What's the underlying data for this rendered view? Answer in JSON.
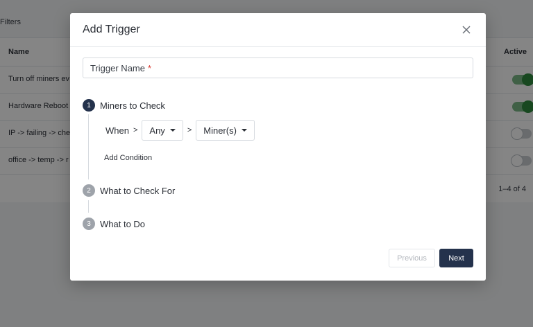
{
  "background": {
    "filters_label": "Filters",
    "columns": {
      "name": "Name",
      "active": "Active"
    },
    "rows": [
      {
        "name": "Turn off miners ev",
        "active": true
      },
      {
        "name": "Hardware Reboot",
        "active": true
      },
      {
        "name": "IP -> failing -> che",
        "active": false
      },
      {
        "name": "office -> temp -> r",
        "active": false
      }
    ],
    "pagination": "1–4 of 4"
  },
  "modal": {
    "title": "Add Trigger",
    "close_icon": "close-icon",
    "trigger_name_placeholder": "Trigger Name",
    "required_mark": "*",
    "steps": [
      {
        "number": "1",
        "label": "Miners to Check",
        "state": "active"
      },
      {
        "number": "2",
        "label": "What to Check For",
        "state": "inactive"
      },
      {
        "number": "3",
        "label": "What to Do",
        "state": "inactive"
      }
    ],
    "condition": {
      "when_label": "When",
      "separator": ">",
      "scope_select": "Any",
      "target_select": "Miner(s)"
    },
    "add_condition_label": "Add Condition",
    "buttons": {
      "previous": "Previous",
      "next": "Next"
    }
  },
  "colors": {
    "primary": "#24324c",
    "required": "#d9342b",
    "toggle_on": "#2f8a3e"
  }
}
